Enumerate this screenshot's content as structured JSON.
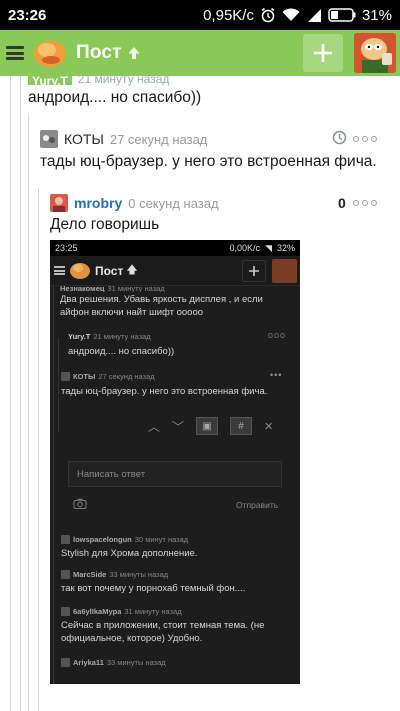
{
  "status_bar": {
    "time": "23:26",
    "speed": "0,95K/c",
    "battery": "31%"
  },
  "app": {
    "title": "Пост"
  },
  "thread": {
    "cut_comment": {
      "user": "Yury.T",
      "time": "21 минуту назад",
      "text": "андроид.... но спасибо))"
    },
    "comment_koty": {
      "user": "КОТЫ",
      "time": "27 секунд назад",
      "text": "тады юц-браузер. у него это встроенная фича."
    },
    "comment_mrobry": {
      "user": "mrobry",
      "time": "0 секунд назад",
      "score": "0",
      "text": "Дело говоришь"
    }
  },
  "embedded_screenshot": {
    "status_bar": {
      "time": "23:25",
      "speed": "0,00K/c",
      "battery": "32%"
    },
    "app_title": "Пост",
    "first_meta": {
      "user": "Незнакомец",
      "time": "31 минуту назад"
    },
    "lines": [
      "Два решения. Убавь яркость дисплея , и если",
      "айфон включи найт шифт ооооо"
    ],
    "reply1": {
      "user": "Yury.T",
      "time": "21 минуту назад",
      "text": "андроид.... но спасибо))"
    },
    "reply2": {
      "user": "КОТЫ",
      "time": "27 секунд назад",
      "text": "тады юц-браузер. у него это встроенная фича."
    },
    "reply_placeholder": "Написать ответ",
    "send_label": "Отправить",
    "toolbar_hash": "#",
    "comments": [
      {
        "user": "lowspacelongun",
        "time": "30 минут назад",
        "text": "Stylish для Хрома дополнение."
      },
      {
        "user": "MarcSide",
        "time": "33 минуты назад",
        "text": "так вот почему у порнохаб темный фон...."
      },
      {
        "user": "6a6ylIkaMypa",
        "time": "31 минуту назад",
        "text": "Сейчас в приложении, стоит темная тема. (не"
      },
      {
        "user": "",
        "time": "",
        "text": "официальное, которое) Удобно."
      },
      {
        "user": "Ariyka11",
        "time": "33 минуты назад",
        "text": ""
      }
    ]
  }
}
